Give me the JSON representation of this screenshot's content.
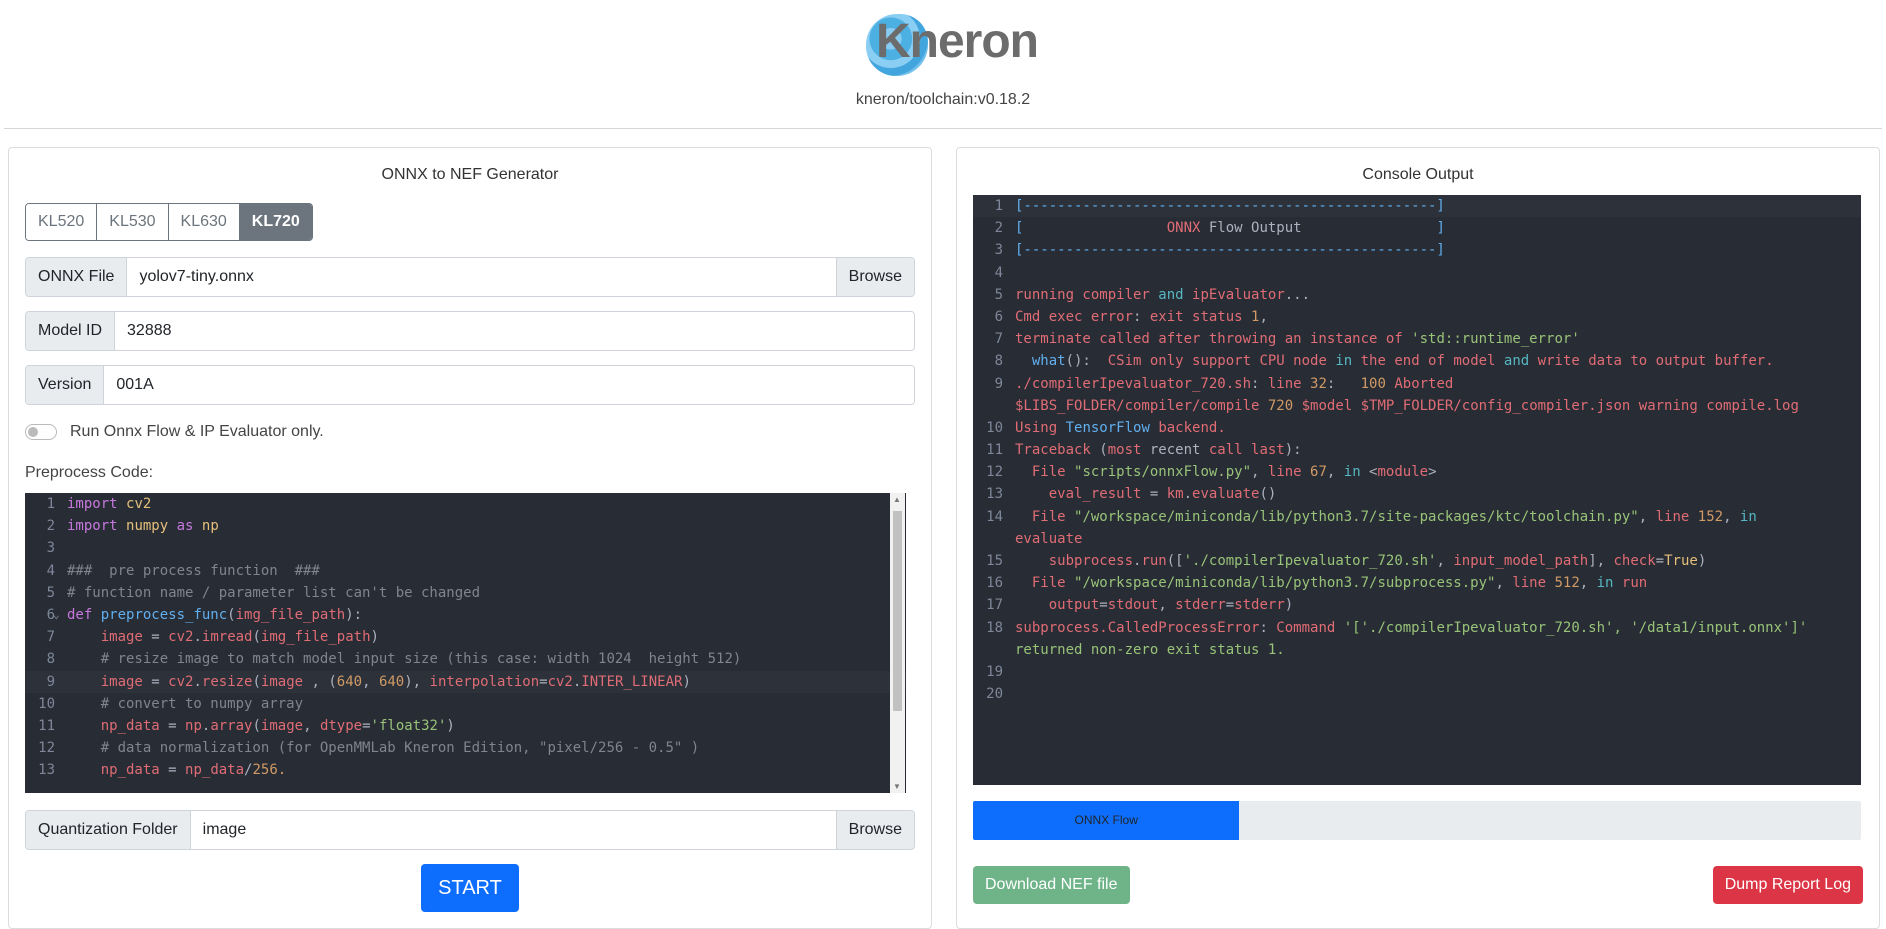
{
  "header": {
    "logo_text": "Kneron",
    "subtitle": "kneron/toolchain:v0.18.2"
  },
  "left_panel": {
    "title": "ONNX to NEF Generator",
    "chip_options": [
      "KL520",
      "KL530",
      "KL630",
      "KL720"
    ],
    "chip_selected": "KL720",
    "onnx_file": {
      "label": "ONNX File",
      "value": "yolov7-tiny.onnx",
      "browse_label": "Browse"
    },
    "model_id": {
      "label": "Model ID",
      "value": "32888"
    },
    "version": {
      "label": "Version",
      "value": "001A"
    },
    "toggle": {
      "label": "Run Onnx Flow & IP Evaluator only.",
      "checked": false
    },
    "preprocess_label": "Preprocess Code:",
    "code_lines": [
      "import cv2",
      "import numpy as np",
      "",
      "###  pre process function  ###",
      "# function name / parameter list can't be changed",
      "def preprocess_func(img_file_path):",
      "    image = cv2.imread(img_file_path)",
      "    # resize image to match model input size (this case: width 1024  height 512)",
      "    image = cv2.resize(image , (640, 640), interpolation=cv2.INTER_LINEAR)",
      "    # convert to numpy array",
      "    np_data = np.array(image, dtype='float32')",
      "    # data normalization (for OpenMMLab Kneron Edition, \"pixel/256 - 0.5\" )",
      "    np_data = np_data/256."
    ],
    "quant_folder": {
      "label": "Quantization Folder",
      "value": "image",
      "browse_label": "Browse"
    },
    "start_label": "START"
  },
  "right_panel": {
    "title": "Console Output",
    "console_lines": [
      "[-------------------------------------------------]",
      "[                 ONNX Flow Output                ]",
      "[-------------------------------------------------]",
      "",
      "running compiler and ipEvaluator...",
      "Cmd exec error: exit status 1,",
      "terminate called after throwing an instance of 'std::runtime_error'",
      "  what():  CSim only support CPU node in the end of model and write data to output buffer.",
      "./compilerIpevaluator_720.sh: line 32:   100 Aborted",
      "$LIBS_FOLDER/compiler/compile 720 $model $TMP_FOLDER/config_compiler.json warning compile.log",
      "Using TensorFlow backend.",
      "Traceback (most recent call last):",
      "  File \"scripts/onnxFlow.py\", line 67, in <module>",
      "    eval_result = km.evaluate()",
      "  File \"/workspace/miniconda/lib/python3.7/site-packages/ktc/toolchain.py\", line 152, in",
      "evaluate",
      "    subprocess.run(['./compilerIpevaluator_720.sh', input_model_path], check=True)",
      "  File \"/workspace/miniconda/lib/python3.7/subprocess.py\", line 512, in run",
      "    output=stdout, stderr=stderr)",
      "subprocess.CalledProcessError: Command '['./compilerIpevaluator_720.sh', '/data1/input.onnx']'",
      "returned non-zero exit status 1.",
      "",
      ""
    ],
    "console_line_numbers": [
      "1",
      "2",
      "3",
      "4",
      "5",
      "6",
      "7",
      "8",
      "9",
      "",
      "10",
      "11",
      "12",
      "13",
      "14",
      "",
      "15",
      "16",
      "17",
      "18",
      "",
      "19",
      "20"
    ],
    "progress": {
      "label": "ONNX Flow",
      "fraction": 0.3
    },
    "download_label": "Download NEF file",
    "dump_label": "Dump Report Log"
  },
  "colors": {
    "primary": "#0d6efd",
    "success_muted": "#6fb489",
    "danger": "#dc3545",
    "editor_bg": "#282c34"
  }
}
